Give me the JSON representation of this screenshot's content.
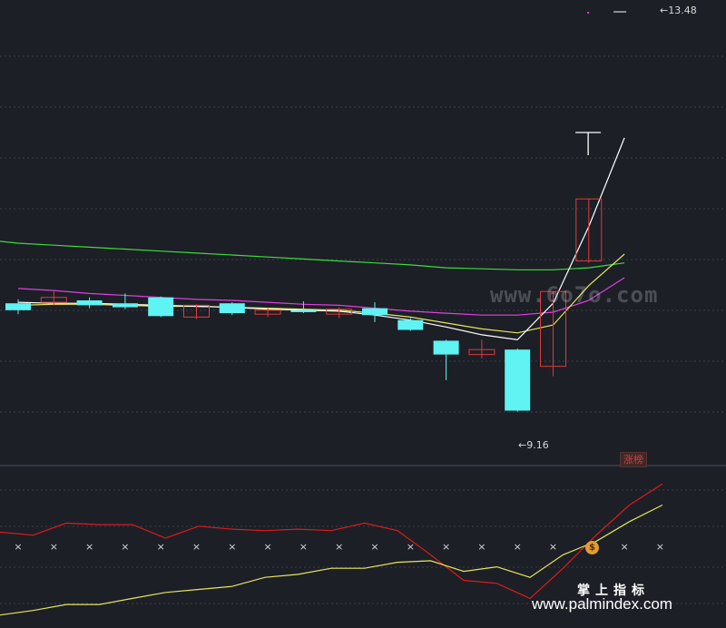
{
  "chart_data": [
    {
      "type": "candlestick",
      "max_label": "13.48",
      "min_label": "9.16",
      "badge": "涨榜",
      "colors": {
        "up": "#e03a3a",
        "down": "#5ff3f3",
        "ma_white": "#ffffff",
        "ma_yellow": "#e6e65a",
        "ma_magenta": "#e040e0",
        "ma_green": "#3ddc3d",
        "grid": "#3a3f4a"
      },
      "yrange": [
        8.9,
        13.6
      ],
      "candles": [
        {
          "o": 10.52,
          "c": 10.45,
          "h": 10.56,
          "l": 10.41
        },
        {
          "o": 10.53,
          "c": 10.58,
          "h": 10.64,
          "l": 10.5
        },
        {
          "o": 10.55,
          "c": 10.5,
          "h": 10.58,
          "l": 10.47
        },
        {
          "o": 10.52,
          "c": 10.48,
          "h": 10.62,
          "l": 10.46
        },
        {
          "o": 10.58,
          "c": 10.39,
          "h": 10.59,
          "l": 10.38
        },
        {
          "o": 10.38,
          "c": 10.5,
          "h": 10.51,
          "l": 10.36
        },
        {
          "o": 10.52,
          "c": 10.42,
          "h": 10.53,
          "l": 10.4
        },
        {
          "o": 10.41,
          "c": 10.45,
          "h": 10.47,
          "l": 10.38
        },
        {
          "o": 10.45,
          "c": 10.43,
          "h": 10.54,
          "l": 10.42
        },
        {
          "o": 10.41,
          "c": 10.46,
          "h": 10.48,
          "l": 10.37
        },
        {
          "o": 10.47,
          "c": 10.4,
          "h": 10.53,
          "l": 10.33
        },
        {
          "o": 10.35,
          "c": 10.25,
          "h": 10.37,
          "l": 10.24
        },
        {
          "o": 10.14,
          "c": 10.0,
          "h": 10.15,
          "l": 9.74
        },
        {
          "o": 10.0,
          "c": 10.05,
          "h": 10.15,
          "l": 9.96
        },
        {
          "o": 10.05,
          "c": 9.43,
          "h": 10.06,
          "l": 9.42
        },
        {
          "o": 9.88,
          "c": 10.64,
          "h": 10.64,
          "l": 9.78
        },
        {
          "o": 10.95,
          "c": 11.58,
          "h": 11.58,
          "l": 10.93
        },
        {
          "o": 13.48,
          "c": 13.48,
          "h": 13.48,
          "l": 13.26
        }
      ],
      "ma_white": [
        10.53,
        10.52,
        10.52,
        10.51,
        10.5,
        10.49,
        10.48,
        10.46,
        10.45,
        10.44,
        10.4,
        10.35,
        10.28,
        10.2,
        10.15,
        10.52,
        11.3,
        12.2
      ],
      "ma_yellow": [
        10.5,
        10.51,
        10.51,
        10.5,
        10.49,
        10.49,
        10.48,
        10.47,
        10.46,
        10.45,
        10.42,
        10.38,
        10.32,
        10.26,
        10.22,
        10.3,
        10.7,
        11.02
      ],
      "ma_magenta": [
        10.67,
        10.65,
        10.62,
        10.6,
        10.58,
        10.56,
        10.55,
        10.53,
        10.51,
        10.5,
        10.47,
        10.44,
        10.42,
        10.4,
        10.4,
        10.43,
        10.55,
        10.78
      ],
      "ma_green": [
        11.13,
        11.11,
        11.09,
        11.07,
        11.05,
        11.03,
        11.01,
        10.99,
        10.97,
        10.95,
        10.93,
        10.91,
        10.88,
        10.87,
        10.86,
        10.86,
        10.88,
        10.93
      ]
    },
    {
      "type": "line",
      "yrange": [
        0,
        100
      ],
      "red": [
        60,
        58,
        66,
        65,
        65,
        56,
        64,
        62,
        61,
        62,
        61,
        66,
        61,
        45,
        28,
        26,
        16,
        36,
        58,
        78,
        92
      ],
      "yellow": [
        5,
        8,
        12,
        12,
        16,
        20,
        22,
        24,
        30,
        32,
        36,
        36,
        40,
        41,
        34,
        37,
        30,
        45,
        54,
        67,
        78
      ],
      "markers": 19
    }
  ],
  "watermarks": {
    "site1": "www.6o7o.com",
    "brand": "掌上指标",
    "site2": "www.palmindex.com"
  },
  "icons": {
    "coin": "money-bag-icon",
    "coin_glyph": "$"
  }
}
